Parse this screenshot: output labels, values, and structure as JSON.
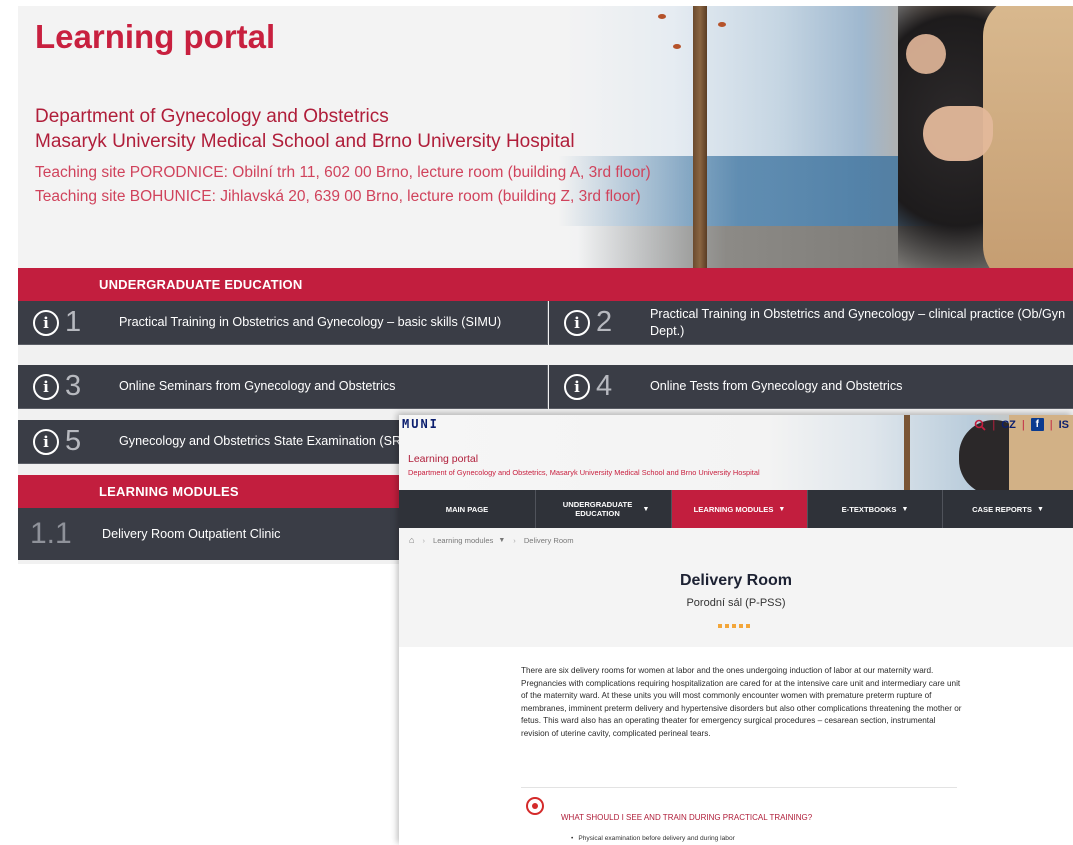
{
  "portal": {
    "title": "Learning portal",
    "department": "Department of Gynecology and Obstetrics",
    "university": "Masaryk University Medical School and Brno University Hospital",
    "site1": "Teaching site PORODNICE: Obilní trh 11, 602 00 Brno, lecture room (building A, 3rd floor)",
    "site2": "Teaching site BOHUNICE: Jihlavská 20, 639 00 Brno, lecture room (building Z, 3rd floor)",
    "undergrad_heading": "UNDERGRADUATE EDUCATION",
    "modules_heading": "LEARNING MODULES",
    "tiles": [
      {
        "num": "1",
        "label": "Practical Training in Obstetrics and Gynecology – basic skills (SIMU)"
      },
      {
        "num": "2",
        "label": "Practical Training in Obstetrics and Gynecology – clinical practice (Ob/Gyn Dept.)"
      },
      {
        "num": "3",
        "label": "Online Seminars from Gynecology and Obstetrics"
      },
      {
        "num": "4",
        "label": "Online Tests from Gynecology and Obstetrics"
      },
      {
        "num": "5",
        "label": "Gynecology and Obstetrics State Examination (SRZ)"
      }
    ],
    "module_tile": {
      "num": "1.1",
      "label": "Delivery Room Outpatient Clinic"
    },
    "info_glyph": "i"
  },
  "page": {
    "brand": "MUNI",
    "portal_title": "Learning portal",
    "portal_subtitle": "Department of Gynecology and Obstetrics, Masaryk University Medical School and Brno University Hospital",
    "header_links": {
      "lang": "CZ",
      "facebook": "f",
      "is": "IS"
    },
    "nav": [
      {
        "label": "MAIN PAGE"
      },
      {
        "label": "UNDERGRADUATE EDUCATION"
      },
      {
        "label": "LEARNING MODULES"
      },
      {
        "label": "E-TEXTBOOKS"
      },
      {
        "label": "CASE REPORTS"
      }
    ],
    "breadcrumb": {
      "modules": "Learning modules",
      "current": "Delivery Room"
    },
    "title": "Delivery Room",
    "local_name": "Porodní sál (P-PSS)",
    "body": "There are six delivery rooms for women at labor and the ones undergoing induction of labor at our maternity ward. Pregnancies with complications requiring hospitalization are cared for at the intensive care unit and intermediary care unit of the maternity ward. At these units you will most commonly encounter women with premature preterm rupture of membranes, imminent preterm delivery and hypertensive disorders but also other complications threatening the mother or fetus. This ward also has an operating theater for emergency surgical procedures – cesarean section, instrumental revision of uterine cavity, complicated perineal tears.",
    "see_heading": "WHAT SHOULD I SEE AND TRAIN DURING PRACTICAL TRAINING?",
    "bullet1": "Physical examination before delivery and during labor"
  },
  "colors": {
    "accent": "#c21e3e",
    "tile_bg": "#3a3d46",
    "dots": "#f3a63a"
  },
  "icons": [
    "info-icon",
    "search-icon",
    "facebook-icon",
    "home-icon",
    "target-icon",
    "caret-down-icon"
  ]
}
